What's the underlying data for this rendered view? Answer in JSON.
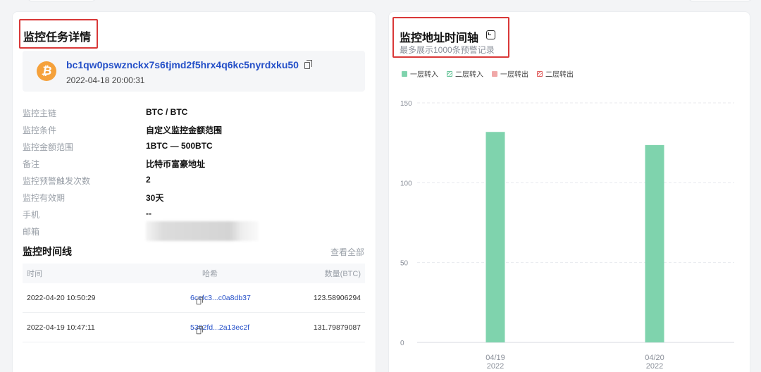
{
  "left": {
    "title": "监控任务详情",
    "address": "bc1qw0pswznckx7s6tjmd2f5hrx4q6kc5nyrdxku50",
    "address_date": "2022-04-18 20:00:31",
    "coin_icon": "bitcoin-icon",
    "fields": [
      {
        "label": "监控主链",
        "value": "BTC / BTC"
      },
      {
        "label": "监控条件",
        "value": "自定义监控金额范围"
      },
      {
        "label": "监控金额范围",
        "value": "1BTC — 500BTC"
      },
      {
        "label": "备注",
        "value": "比特币富豪地址"
      },
      {
        "label": "监控预警触发次数",
        "value": "2"
      },
      {
        "label": "监控有效期",
        "value": "30天"
      },
      {
        "label": "手机",
        "value": "--"
      },
      {
        "label": "邮箱",
        "value": ""
      }
    ],
    "timeline": {
      "title": "监控时间线",
      "view_all": "查看全部",
      "columns": [
        "时间",
        "哈希",
        "数量(BTC)"
      ],
      "rows": [
        {
          "time": "2022-04-20 10:50:29",
          "hash": "6cefc3...c0a8db37",
          "amount": "123.58906294"
        },
        {
          "time": "2022-04-19 10:47:11",
          "hash": "5362fd...2a13ec2f",
          "amount": "131.79879087"
        }
      ]
    }
  },
  "right": {
    "title": "监控地址时间轴",
    "subtitle": "最多展示1000条预警记录",
    "legend": [
      {
        "label": "一层转入",
        "color": "#7fd3ad",
        "style": "solid"
      },
      {
        "label": "二层转入",
        "color": "#7fd3ad",
        "style": "hatched"
      },
      {
        "label": "一层转出",
        "color": "#f0a8a8",
        "style": "solid"
      },
      {
        "label": "二层转出",
        "color": "#e06060",
        "style": "hatched"
      }
    ]
  },
  "chart_data": {
    "type": "bar",
    "categories": [
      "04/19\n2022",
      "04/20\n2022"
    ],
    "category_labels": [
      [
        "04/19",
        "2022"
      ],
      [
        "04/20",
        "2022"
      ]
    ],
    "series": [
      {
        "name": "一层转入",
        "values": [
          131.79879087,
          123.58906294
        ],
        "color": "#7fd3ad"
      }
    ],
    "ylim": [
      0,
      150
    ],
    "yticks": [
      0,
      50,
      100,
      150
    ],
    "grid": true,
    "legend_position": "top-left"
  }
}
